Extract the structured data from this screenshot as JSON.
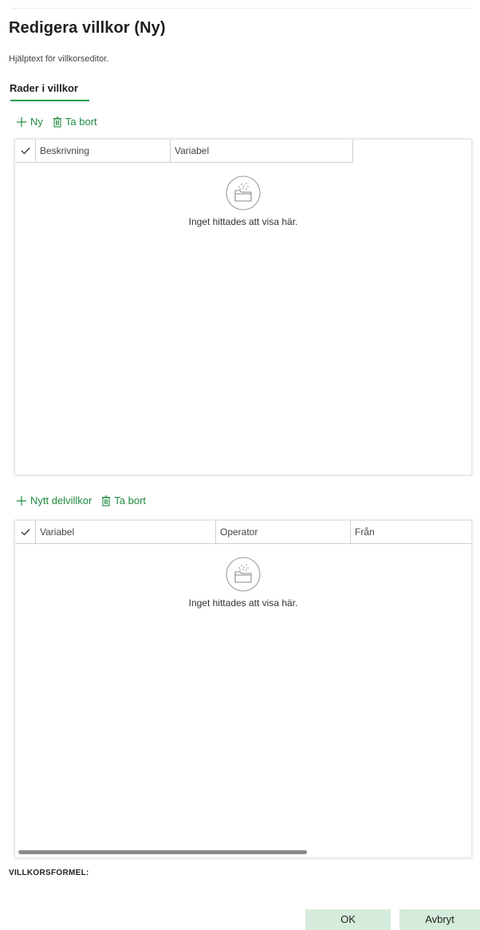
{
  "dialog": {
    "title": "Redigera villkor (Ny)",
    "help_text": "Hjälptext för villkorseditor.",
    "tab_label": "Rader i villkor"
  },
  "rows_section": {
    "toolbar": {
      "new_label": "Ny",
      "delete_label": "Ta bort"
    },
    "columns": [
      "Beskrivning",
      "Variabel"
    ],
    "rows": [],
    "empty_message": "Inget hittades att visa här."
  },
  "subconditions_section": {
    "toolbar": {
      "new_label": "Nytt delvillkor",
      "delete_label": "Ta bort"
    },
    "columns": [
      "Variabel",
      "Operator",
      "Från"
    ],
    "rows": [],
    "empty_message": "Inget hittades att visa här."
  },
  "formula_label": "VILLKORSFORMEL:",
  "buttons": {
    "ok_label": "OK",
    "cancel_label": "Avbryt"
  },
  "colors": {
    "accent_green": "#1f8a3f",
    "button_bg": "#d5ebdb"
  },
  "icons": {
    "add": "plus-icon",
    "delete": "trash-icon",
    "select_all": "checkmark-icon",
    "empty": "empty-folder-icon"
  }
}
